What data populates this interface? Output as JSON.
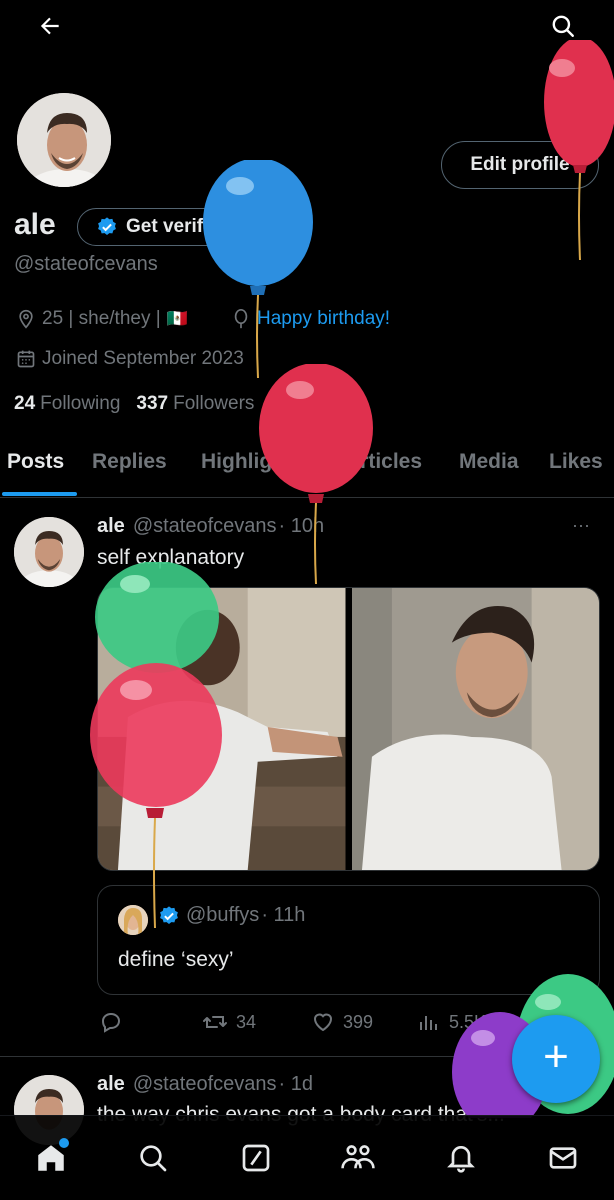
{
  "header": {
    "back_icon": "arrow-left-icon",
    "search_icon": "search-icon"
  },
  "profile": {
    "display_name": "ale",
    "verify_label": "Get verified",
    "handle": "@stateofcevans",
    "edit_label": "Edit profile",
    "bio_meta": "25 | she/they |",
    "flag": "🇲🇽",
    "birthday": "Happy birthday!",
    "joined": "Joined September 2023",
    "following_count": "24",
    "following_label": "Following",
    "followers_count": "337",
    "followers_label": "Followers"
  },
  "tabs": [
    {
      "label": "Posts",
      "active": true
    },
    {
      "label": "Replies"
    },
    {
      "label": "Highlights"
    },
    {
      "label": "Articles"
    },
    {
      "label": "Media"
    },
    {
      "label": "Likes"
    }
  ],
  "post1": {
    "name": "ale",
    "handle": "@stateofcevans",
    "time": "· 10h",
    "text": "self explanatory",
    "more": "···",
    "quote": {
      "handle": "@buffys",
      "time": "· 11h",
      "text": "define ‘sexy’"
    },
    "stats": {
      "retweets": "34",
      "likes": "399",
      "views": "5.5K"
    }
  },
  "post2": {
    "name": "ale",
    "handle": "@stateofcevans",
    "time": "· 1d",
    "text": "the way chris evans got a body card that's..."
  },
  "nav": [
    "home-icon",
    "search-icon",
    "grok-icon",
    "communities-icon",
    "notifications-icon",
    "messages-icon"
  ],
  "fab_label": "+",
  "colors": {
    "accent": "#1d9bf0",
    "background": "#000000",
    "muted": "#71767b",
    "text": "#e7e9ea"
  }
}
